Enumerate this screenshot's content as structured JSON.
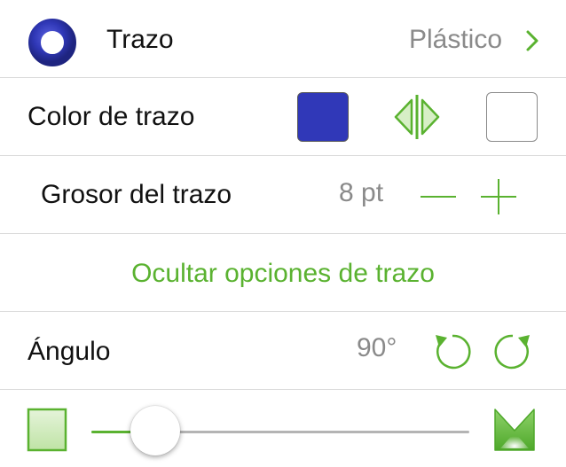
{
  "colors": {
    "accent": "#5ab230",
    "stroke_color": "#3038b8",
    "fill_color": "#ffffff",
    "muted_text": "#8a8a8a"
  },
  "stroke_row": {
    "icon": "stroke-ring-icon",
    "label": "Trazo",
    "style_value": "Plástico",
    "chevron_icon": "chevron-right-icon"
  },
  "color_row": {
    "label": "Color de trazo",
    "swap_icon": "swap-colors-icon"
  },
  "thickness_row": {
    "label": "Grosor del trazo",
    "value": "8 pt",
    "decrement_icon": "minus-icon",
    "increment_icon": "plus-icon"
  },
  "options_row": {
    "hide_label": "Ocultar opciones de trazo"
  },
  "angle_row": {
    "label": "Ángulo",
    "value": "90°",
    "rotate_left_icon": "rotate-ccw-icon",
    "rotate_right_icon": "rotate-cw-icon"
  },
  "end_slider": {
    "left_icon": "square-end-icon",
    "right_icon": "beveled-end-icon",
    "value_fraction": 0.17
  }
}
